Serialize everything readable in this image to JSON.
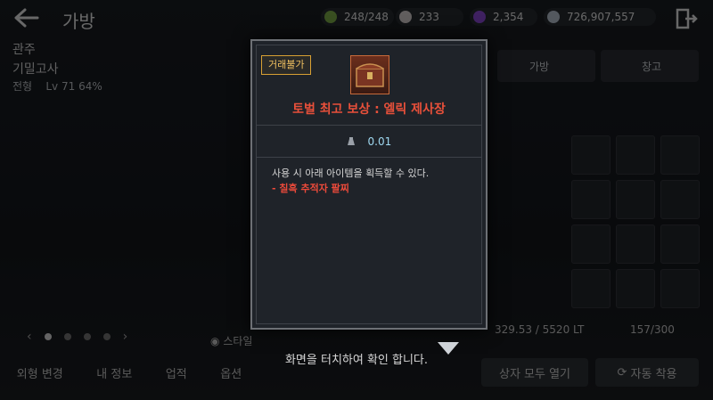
{
  "header": {
    "title": "가방",
    "currencies": [
      {
        "icon": "stamina-icon",
        "value": "248/248",
        "color": "#7fb04a"
      },
      {
        "icon": "pearl-icon",
        "value": "233",
        "color": "#d8d0d0"
      },
      {
        "icon": "crystal-icon",
        "value": "2,354",
        "color": "#8c4bd8"
      },
      {
        "icon": "silver-icon",
        "value": "726,907,557",
        "color": "#b8c4d0"
      }
    ]
  },
  "character": {
    "title_line": "관주",
    "subtitle_line": "기밀고사",
    "level_label": "전형",
    "level": "Lv 71",
    "level_pct": "64%"
  },
  "background": {
    "right_tabs": [
      "가방",
      "창고"
    ],
    "bottom_nav": [
      "외형 변경",
      "내 정보",
      "업적",
      "옵션"
    ],
    "weight_text": "329.53 / 5520 LT",
    "slot_text": "157/300",
    "open_all_button": "상자 모두 열기",
    "auto_equip_button": "자동 착용",
    "starter_label": "스타일"
  },
  "modal": {
    "trade_badge": "거래불가",
    "item_name": "토벌 최고 보상 : 엘릭 제사장",
    "weight": "0.01",
    "description": "사용 시 아래 아이템을 획득할 수 있다.",
    "reward_item": "- 칠흑 추적자 팔찌"
  },
  "footer": {
    "touch_hint": "화면을 터치하여 확인 합니다."
  },
  "colors": {
    "item_name": "#e8503a",
    "trade_badge_border": "#d8a033",
    "reward_text": "#ec4a3a"
  }
}
